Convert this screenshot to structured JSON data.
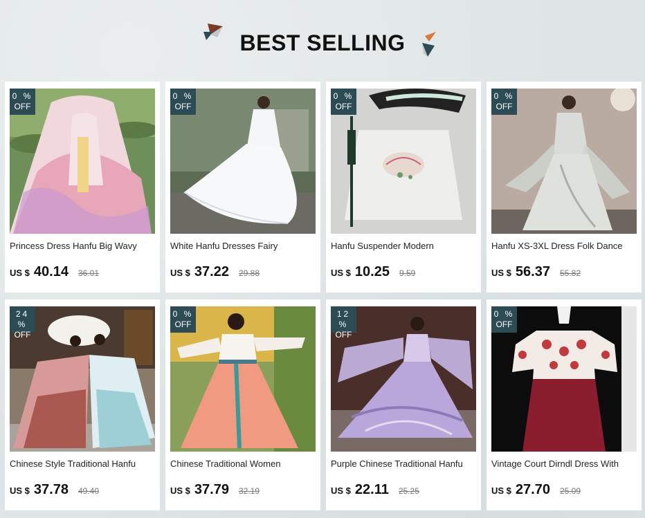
{
  "header": {
    "title": "BEST SELLING"
  },
  "colors": {
    "badge": "#2d4b55",
    "accent_orange": "#d97a3a",
    "accent_dark": "#2d4b55"
  },
  "currency": "US $",
  "products": [
    {
      "name": "Princess Dress Hanfu Big Wavy",
      "discount": "0 %",
      "off": "OFF",
      "price": "40.14",
      "old_price": "36.01"
    },
    {
      "name": "White Hanfu Dresses Fairy",
      "discount": "0 %",
      "off": "OFF",
      "price": "37.22",
      "old_price": "29.88"
    },
    {
      "name": "Hanfu Suspender Modern",
      "discount": "0 %",
      "off": "OFF",
      "price": "10.25",
      "old_price": "9.59"
    },
    {
      "name": "Hanfu XS-3XL Dress Folk Dance",
      "discount": "0 %",
      "off": "OFF",
      "price": "56.37",
      "old_price": "55.82"
    },
    {
      "name": "Chinese Style Traditional Hanfu",
      "discount": "24 %",
      "off": "OFF",
      "price": "37.78",
      "old_price": "49.40"
    },
    {
      "name": "Chinese Traditional Women",
      "discount": "0 %",
      "off": "OFF",
      "price": "37.79",
      "old_price": "32.19"
    },
    {
      "name": "Purple Chinese Traditional Hanfu",
      "discount": "12 %",
      "off": "OFF",
      "price": "22.11",
      "old_price": "25.25"
    },
    {
      "name": "Vintage Court Dirndl Dress With",
      "discount": "0 %",
      "off": "OFF",
      "price": "27.70",
      "old_price": "25.09"
    }
  ]
}
